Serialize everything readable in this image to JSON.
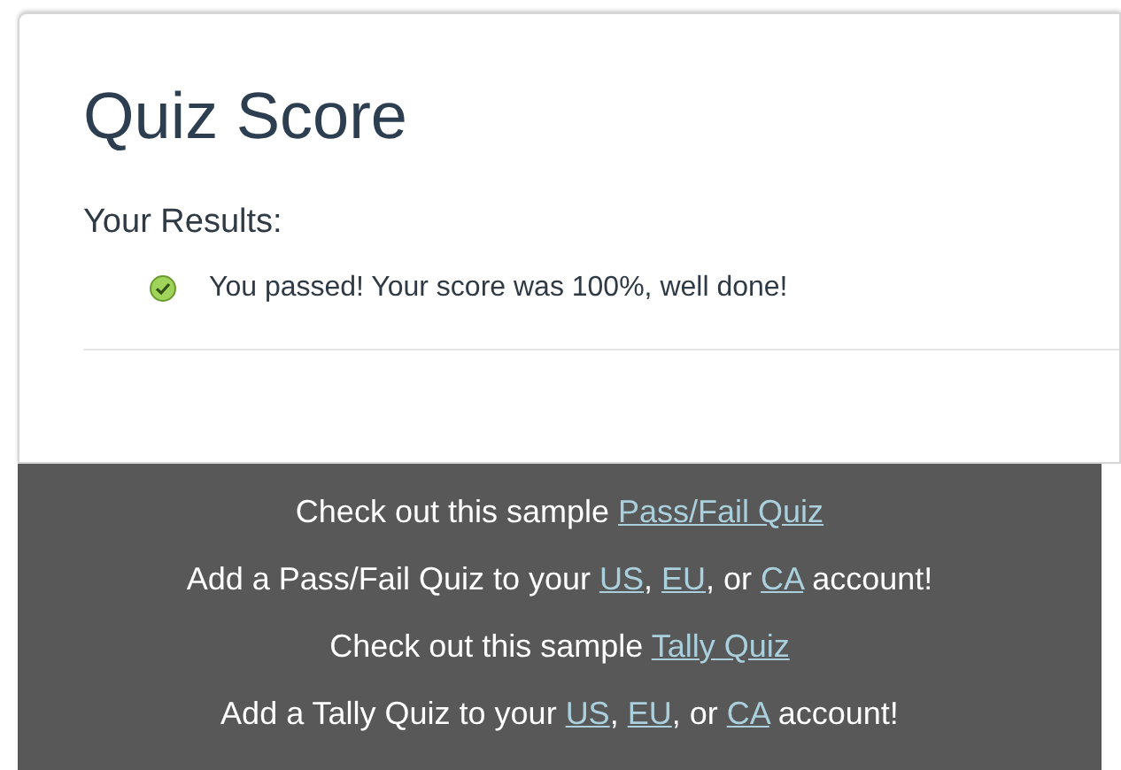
{
  "card": {
    "title": "Quiz Score",
    "results_heading": "Your Results:",
    "result": {
      "passed": true,
      "text": "You passed! Your score was 100%, well done!"
    }
  },
  "promo_lines": [
    {
      "segments": [
        {
          "kind": "text",
          "text": "Check out this sample "
        },
        {
          "kind": "link",
          "text": "Pass/Fail Quiz"
        }
      ]
    },
    {
      "segments": [
        {
          "kind": "text",
          "text": "Add a Pass/Fail Quiz to your "
        },
        {
          "kind": "link",
          "text": "US"
        },
        {
          "kind": "text",
          "text": ", "
        },
        {
          "kind": "link",
          "text": "EU"
        },
        {
          "kind": "text",
          "text": ", or "
        },
        {
          "kind": "link",
          "text": "CA"
        },
        {
          "kind": "text",
          "text": " account!"
        }
      ]
    },
    {
      "segments": [
        {
          "kind": "text",
          "text": "Check out this sample "
        },
        {
          "kind": "link",
          "text": "Tally Quiz"
        }
      ]
    },
    {
      "segments": [
        {
          "kind": "text",
          "text": "Add a Tally Quiz to your "
        },
        {
          "kind": "link",
          "text": "US"
        },
        {
          "kind": "text",
          "text": ", "
        },
        {
          "kind": "link",
          "text": "EU"
        },
        {
          "kind": "text",
          "text": ", or "
        },
        {
          "kind": "link",
          "text": "CA"
        },
        {
          "kind": "text",
          "text": " account!"
        }
      ]
    }
  ]
}
